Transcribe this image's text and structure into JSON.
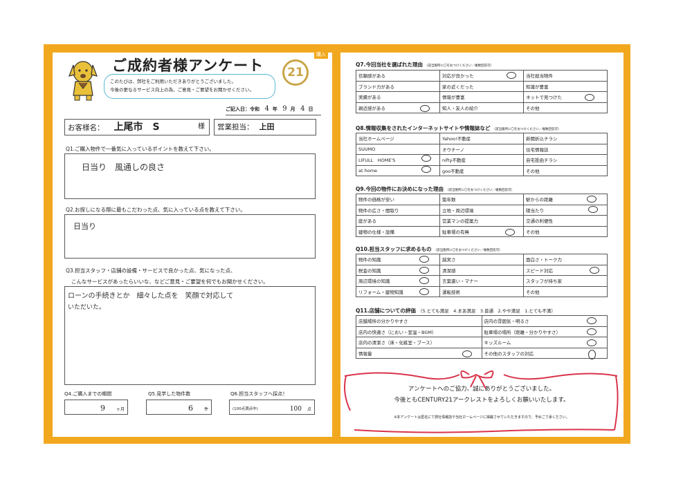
{
  "header": {
    "tag": "購入",
    "title": "ご成約者様アンケート",
    "bubble_line1": "このたびは、弊社をご利用いただきありがとうございました。",
    "bubble_line2": "今後の更なるサービス向上の為、ご意見・ご要望をお聞かせください。",
    "logo": "21"
  },
  "entry_date": {
    "prefix": "ご記入日：令和",
    "year": "4",
    "year_unit": "年",
    "month": "9",
    "month_unit": "月",
    "day": "4",
    "day_unit": "日"
  },
  "customer": {
    "label": "お客様名：",
    "value": "上尾市　S",
    "suffix": "様",
    "staff_label": "営業担当：",
    "staff_value": "上田"
  },
  "q1": {
    "label": "Q1.ご購入物件で一番気に入っているポイントを教えて下さい。",
    "answer": "日当り　風通しの良さ"
  },
  "q2": {
    "label": "Q2.お探しになる際に最もこだわった点、気に入っている点を教えて下さい。",
    "answer": "日当り"
  },
  "q3": {
    "label1": "Q3.担当スタッフ・店舗の設備・サービスで良かった点、気になった点、",
    "label2": "こんなサービスがあったらいいな、などご意見・ご要望を何でもお聞かせください。",
    "answer1": "ローンの手続きとか　細々した点を　笑顔で対応して",
    "answer2": "いただいた。"
  },
  "q4": {
    "label": "Q4.ご購入までの期間",
    "value": "9",
    "unit": "ヶ月"
  },
  "q5": {
    "label": "Q5.見学した物件数",
    "value": "6",
    "unit": "件"
  },
  "q6": {
    "label": "Q6.担当スタッフへ採点！",
    "prefix": "(100点満点中)",
    "value": "100",
    "unit": "点"
  },
  "q7": {
    "label": "Q7.今回当社を選ばれた理由",
    "note": "（該当箇所に〇をおつけください／複数回答可）",
    "rows": [
      [
        "信頼感がある",
        "対応が良かった",
        "当社担当物件"
      ],
      [
        "ブランド力がある",
        "家の近くだった",
        "知識が豊富"
      ],
      [
        "実績がある",
        "情報が豊富",
        "ネットで見つけた"
      ],
      [
        "親近感がある",
        "知人・友人の紹介",
        "その他"
      ]
    ]
  },
  "q8": {
    "label": "Q8.情報収集をされたインターネットサイトや情報誌など",
    "note": "（該当箇所に〇をおつけください／複数回答可）",
    "rows": [
      [
        "当社ホームページ",
        "Yahoo!不動産",
        "新聞折込チラシ"
      ],
      [
        "SUUMO",
        "オウチーノ",
        "住宅情報誌"
      ],
      [
        "LIFULL　HOME'S",
        "nifty不動産",
        "自宅投函チラシ"
      ],
      [
        "at home",
        "goo不動産",
        "その他"
      ]
    ]
  },
  "q9": {
    "label": "Q9.今回の物件にお決めになった理由",
    "note": "（該当箇所に〇をおつけください／複数回答可）",
    "rows": [
      [
        "物件の価格が安い",
        "築年数",
        "駅からの距離"
      ],
      [
        "物件の広さ・間取り",
        "立地・周辺環境",
        "陽当たり"
      ],
      [
        "庭がある",
        "営業マンの提案力",
        "交通の利便性"
      ],
      [
        "建物の仕様・設備",
        "駐車場の有無",
        "その他"
      ]
    ]
  },
  "q10": {
    "label": "Q10.担当スタッフに求めるもの",
    "note": "（該当箇所に〇をおつけください／複数回答可）",
    "rows": [
      [
        "物件の知識",
        "誠実さ",
        "面白さ・トーク力"
      ],
      [
        "税金の知識",
        "清潔感",
        "スピード対応"
      ],
      [
        "周辺環境の知識",
        "言葉遣い・マナー",
        "スタッフが持ち家"
      ],
      [
        "リフォーム・建物知識",
        "運転技術",
        "その他"
      ]
    ]
  },
  "q11": {
    "label": "Q11.店舗についての評価",
    "scale": "（5.とても満足　4.まあ満足　3.普通　2.やや満足　1.とても不満）",
    "rows": [
      [
        "店舗場所の分かりやすさ",
        "店内の雰囲気・明るさ"
      ],
      [
        "店内の快適さ（におい・室温・BGM）",
        "駐車場の場所（距離・分かりやすさ）"
      ],
      [
        "店内の清潔さ（床・化粧室・ブース）",
        "キッズルーム"
      ],
      [
        "情報量",
        "その他のスタッフの対応"
      ]
    ]
  },
  "thanks": {
    "line1": "アンケートへのご協力、誠にありがとうございました。",
    "line2": "今後ともCENTURY21アークレストをよろしくお願いいたします。",
    "line3": "※本アンケートは匿名にて弊社情報誌や当社ホームページに掲載させていただきますので、予めご了承ください。"
  },
  "colors": {
    "frame": "#f2a81e",
    "bubble_border": "#57b6d2",
    "ribbon": "#d9334a",
    "logo_gold": "#c9a447"
  }
}
